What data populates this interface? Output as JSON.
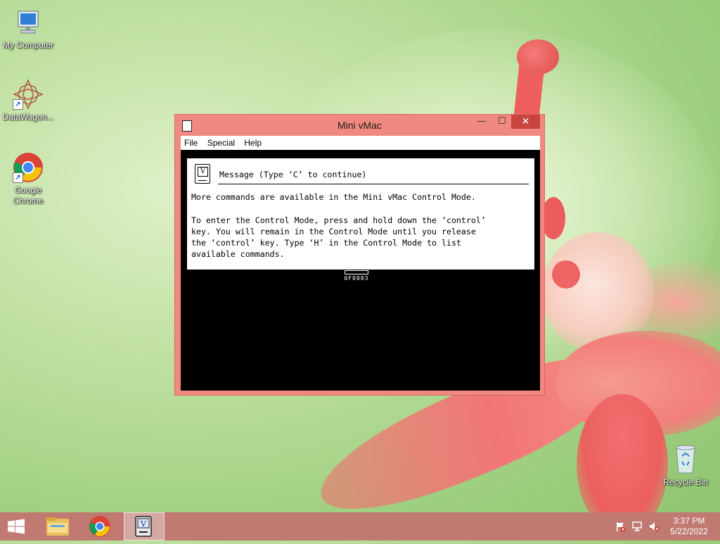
{
  "desktop": {
    "icons": [
      {
        "label": "My Computer",
        "icon": "computer-icon"
      },
      {
        "label": "DataWagon...",
        "icon": "datawagon-icon"
      },
      {
        "label": "Google Chrome",
        "icon": "chrome-icon"
      }
    ],
    "recycle_bin": {
      "label": "Recycle Bin",
      "icon": "recycle-bin-icon"
    }
  },
  "window": {
    "title": "Mini vMac",
    "controls": {
      "minimize": "—",
      "maximize": "☐",
      "close": "✕"
    },
    "menu": [
      "File",
      "Special",
      "Help"
    ],
    "message": {
      "title": "Message (Type ‘C’ to continue)",
      "line1": "More commands are available in the Mini vMac Control Mode.",
      "body": "To enter the Control Mode, press and hold down the ‘control’\nkey. You will remain in the Control Mode until you release\nthe ‘control’ key. Type ‘H’ in the Control Mode to list\navailable commands."
    },
    "status_code": "0F0003"
  },
  "taskbar": {
    "items": [
      "start-icon",
      "file-explorer-icon",
      "chrome-icon",
      "mini-vmac-icon"
    ],
    "tray": [
      "action-center-flag-icon",
      "network-icon",
      "volume-muted-icon"
    ],
    "time": "3:37 PM",
    "date": "5/22/2022"
  },
  "colors": {
    "accent": "#f08a80",
    "taskbar": "#c07a72",
    "close": "#c7443f"
  }
}
